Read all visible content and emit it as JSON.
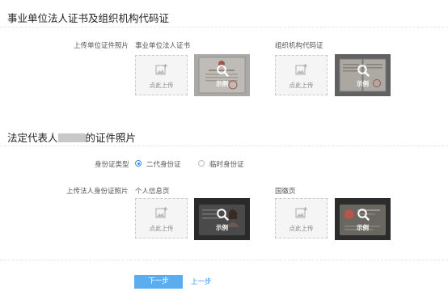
{
  "section1": {
    "title": "事业单位法人证书及组织机构代码证",
    "upload_label": "上传单位证件照片",
    "cert1_title": "事业单位法人证书",
    "cert2_title": "组织机构代码证"
  },
  "section2": {
    "title_prefix": "法定代表人",
    "title_suffix": "的证件照片",
    "idtype_label": "身份证类型",
    "radio1_label": "二代身份证",
    "radio2_label": "临时身份证",
    "upload_label": "上传法人身份证照片",
    "id_front_title": "个人信息页",
    "id_back_title": "国徽页"
  },
  "upload_text": "点此上传",
  "sample_text": "示例",
  "buttons": {
    "next": "下一步",
    "prev": "上一步"
  },
  "colors": {
    "accent": "#3a8ee6",
    "button_bg": "#5aaef0"
  },
  "icons": [
    "image-upload-icon",
    "magnifier-icon"
  ]
}
